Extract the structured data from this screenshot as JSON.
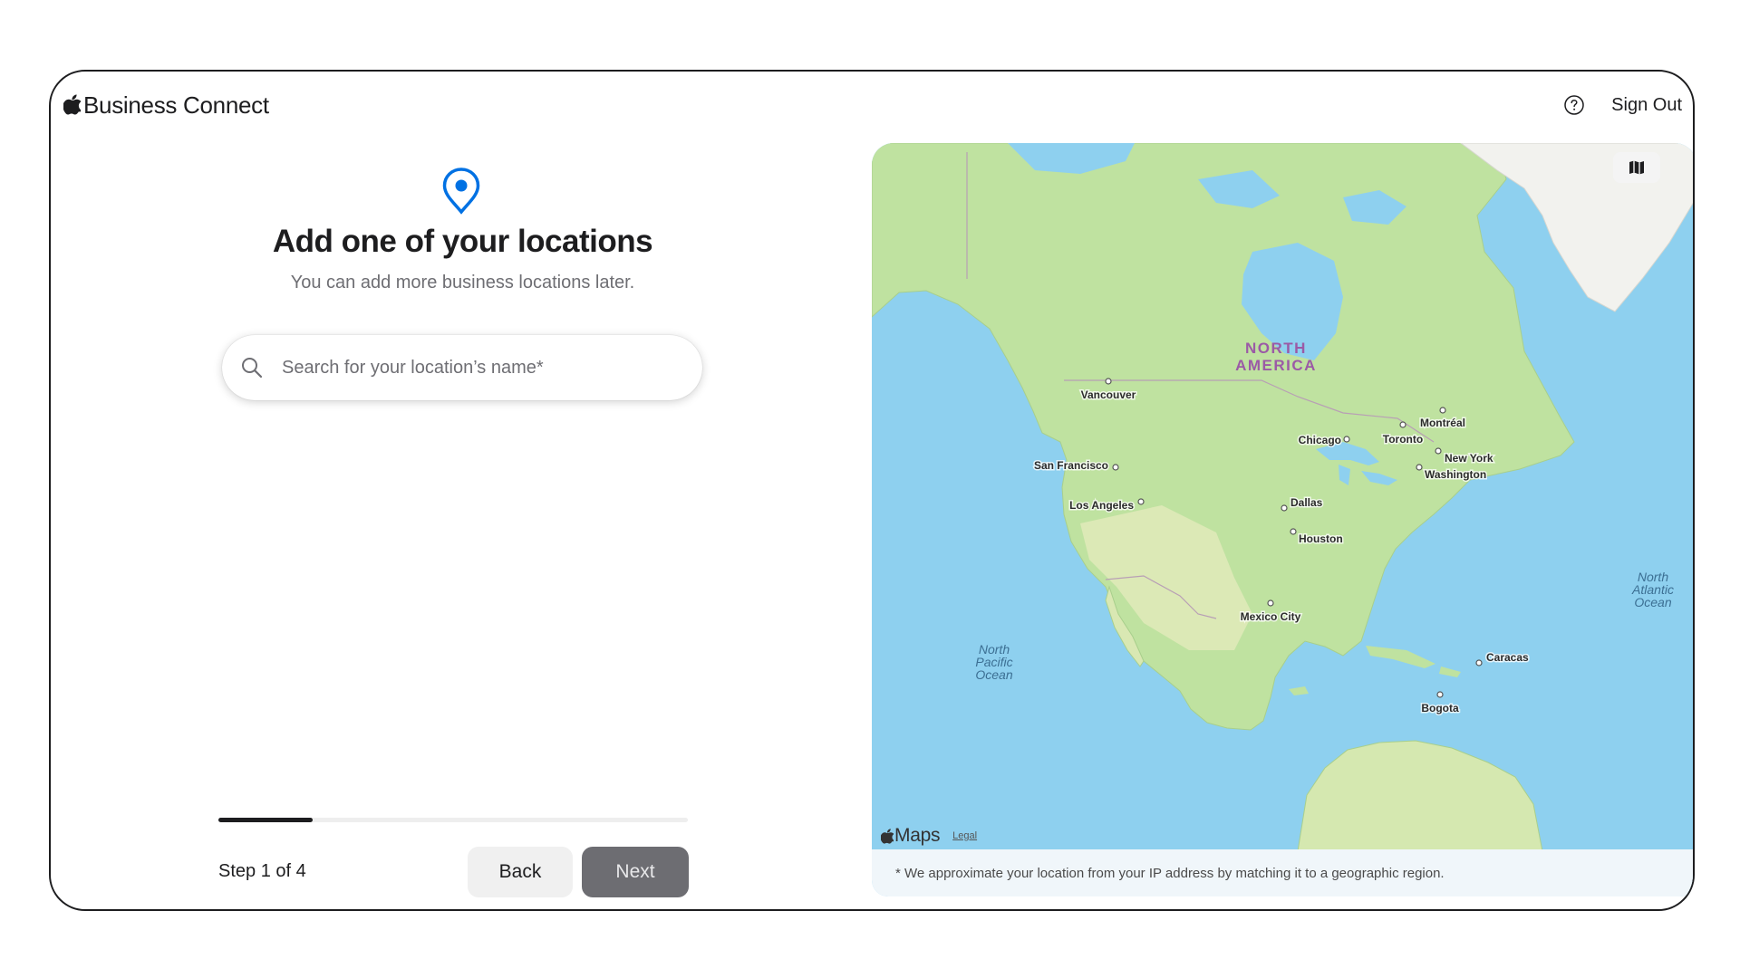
{
  "header": {
    "brand": "Business Connect",
    "sign_out": "Sign Out"
  },
  "content": {
    "title": "Add one of your locations",
    "subtitle": "You can add more business locations later.",
    "search_placeholder": "Search for your location’s name*",
    "search_value": ""
  },
  "footer": {
    "step": "Step 1 of 4",
    "progress": 0.2,
    "back": "Back",
    "next": "Next"
  },
  "map": {
    "continent_line1": "NORTH",
    "continent_line2": "AMERICA",
    "cities": {
      "vancouver": "Vancouver",
      "montreal": "Montréal",
      "chicago": "Chicago",
      "toronto": "Toronto",
      "new_york": "New York",
      "washington": "Washington",
      "san_francisco": "San Francisco",
      "los_angeles": "Los Angeles",
      "dallas": "Dallas",
      "houston": "Houston",
      "mexico_city": "Mexico City",
      "caracas": "Caracas",
      "bogota": "Bogota"
    },
    "oceans": {
      "pacific": [
        "North",
        "Pacific",
        "Ocean"
      ],
      "atlantic": [
        "North",
        "Atlantic",
        "Ocean"
      ]
    },
    "attribution": "Maps",
    "legal": "Legal",
    "note": "* We approximate your location from your IP address by matching it to a geographic region."
  },
  "colors": {
    "accent": "#0071e3",
    "land": "#bfe2a0",
    "water": "#8ed0ef"
  }
}
